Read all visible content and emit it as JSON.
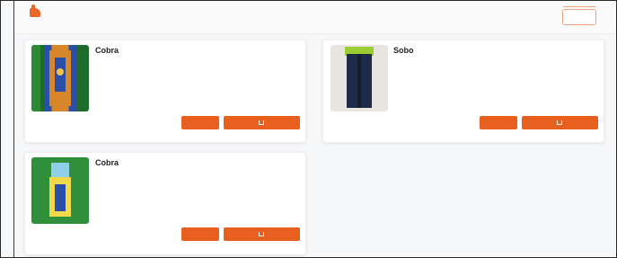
{
  "header": {
    "logo_text": "",
    "login_label": ""
  },
  "products": [
    {
      "name": "Cobra",
      "subtitle": "",
      "meta": "",
      "buy_label": "",
      "cart_label": ""
    },
    {
      "name": "Sobo",
      "subtitle": "",
      "meta": "",
      "buy_label": "",
      "cart_label": ""
    },
    {
      "name": "Cobra",
      "subtitle": "",
      "meta": "",
      "buy_label": "",
      "cart_label": ""
    }
  ],
  "colors": {
    "accent": "#e8601f"
  }
}
